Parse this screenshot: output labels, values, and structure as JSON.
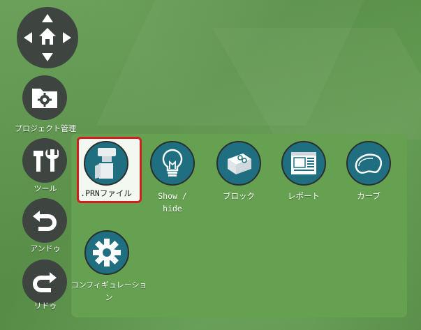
{
  "rail": {
    "nav_pad": {
      "icon": "home-dpad-icon"
    },
    "project": {
      "label": "プロジェクト管理",
      "icon": "folder-gear-icon"
    },
    "tools": {
      "label": "ツール",
      "icon": "wrench-hammer-icon"
    },
    "undo": {
      "label": "アンドゥ",
      "icon": "undo-arrow-icon"
    },
    "redo": {
      "label": "リドゥ",
      "icon": "redo-arrow-icon"
    }
  },
  "panel": {
    "tools": [
      {
        "label": ".PRNファイル",
        "icon": "prn-file-icon",
        "selected": true
      },
      {
        "label": "Show / hide",
        "icon": "lightbulb-icon"
      },
      {
        "label": "ブロック",
        "icon": "block-icon"
      },
      {
        "label": "レポート",
        "icon": "report-icon"
      },
      {
        "label": "カーブ",
        "icon": "curve-icon"
      },
      {
        "label": "コンフィギュレーション",
        "icon": "gear-icon"
      }
    ]
  },
  "colors": {
    "background": "#5f9b4d",
    "panel": "#66a152",
    "rail_button": "#3e4541",
    "tool_button": "#1f6f80",
    "selection_border": "#d41e1e"
  }
}
